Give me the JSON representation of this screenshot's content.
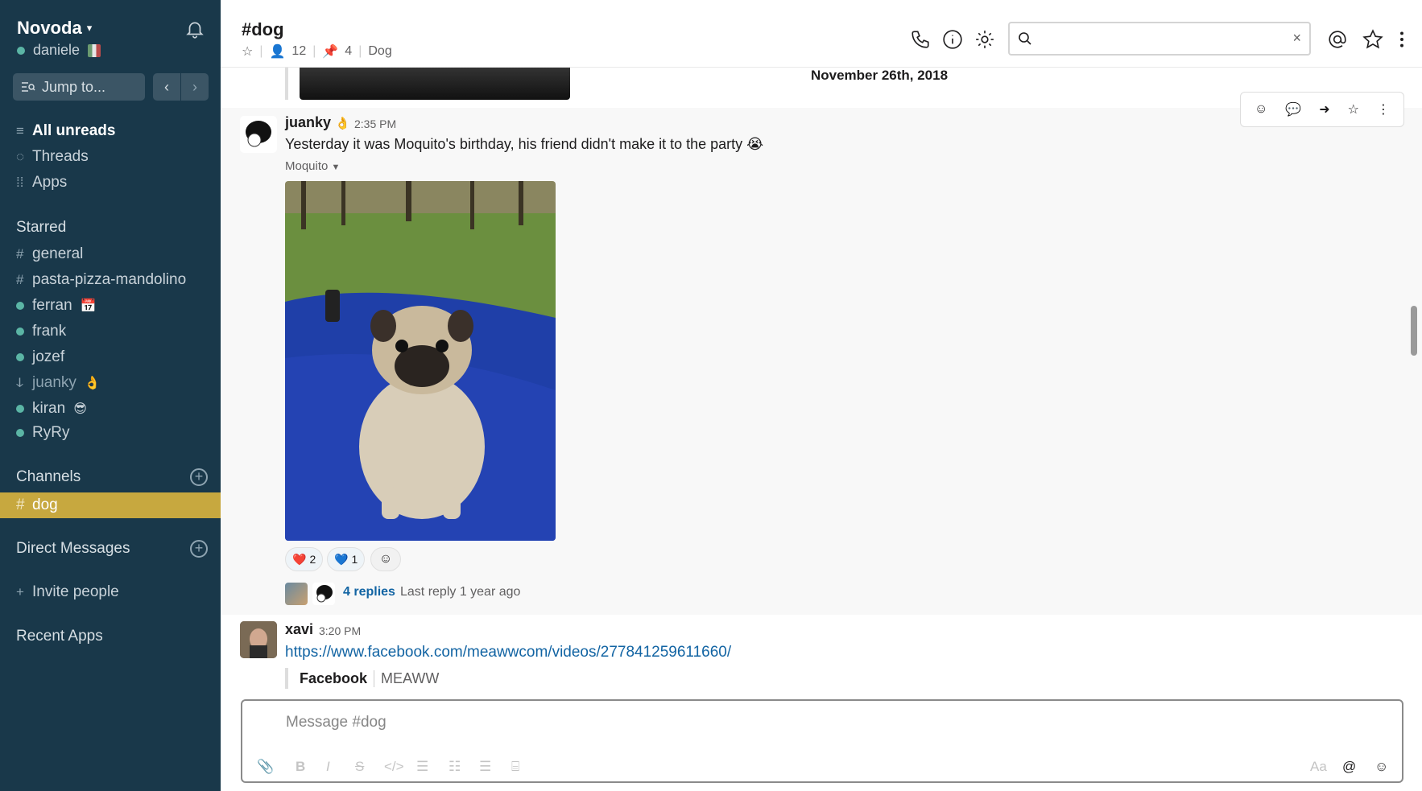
{
  "sidebar": {
    "workspace": "Novoda",
    "user": "daniele",
    "jump_to": "Jump to...",
    "top_items": [
      {
        "label": "All unreads",
        "icon": "lines-icon"
      },
      {
        "label": "Threads",
        "icon": "thread-icon"
      },
      {
        "label": "Apps",
        "icon": "grid-icon"
      }
    ],
    "starred_heading": "Starred",
    "starred": [
      {
        "label": "general",
        "prefix": "#"
      },
      {
        "label": "pasta-pizza-mandolino",
        "prefix": "#"
      },
      {
        "label": "ferran",
        "prefix": "dot"
      },
      {
        "label": "frank",
        "prefix": "dot"
      },
      {
        "label": "jozef",
        "prefix": "dot"
      },
      {
        "label": "juanky",
        "prefix": "away"
      },
      {
        "label": "kiran",
        "prefix": "dot"
      },
      {
        "label": "RyRy",
        "prefix": "dot"
      }
    ],
    "channels_heading": "Channels",
    "active_channel": "dog",
    "dm_heading": "Direct Messages",
    "invite": "Invite people",
    "recent_apps": "Recent Apps"
  },
  "header": {
    "channel": "#dog",
    "members": "12",
    "pins": "4",
    "topic": "Dog",
    "search_value": ""
  },
  "messages": {
    "date_divider": "November 26th, 2018",
    "m1": {
      "author": "juanky",
      "time": "2:35 PM",
      "text": "Yesterday it was Moquito's birthday, his friend didn't make it to the party 😭",
      "file": "Moquito",
      "reactions": [
        {
          "emoji": "❤️",
          "count": "2"
        },
        {
          "emoji": "💙",
          "count": "1"
        }
      ],
      "replies": "4 replies",
      "last_reply": "Last reply 1 year ago"
    },
    "m2": {
      "author": "xavi",
      "time": "3:20 PM",
      "link": "https://www.facebook.com/meawwcom/videos/277841259611660/",
      "unfurl_title": "Facebook",
      "unfurl_sub": "MEAWW"
    }
  },
  "composer": {
    "placeholder": "Message #dog",
    "font_toggle": "Aa"
  },
  "colors": {
    "sidebar": "#19384a",
    "active": "#c7a83f",
    "link": "#1264a3"
  }
}
